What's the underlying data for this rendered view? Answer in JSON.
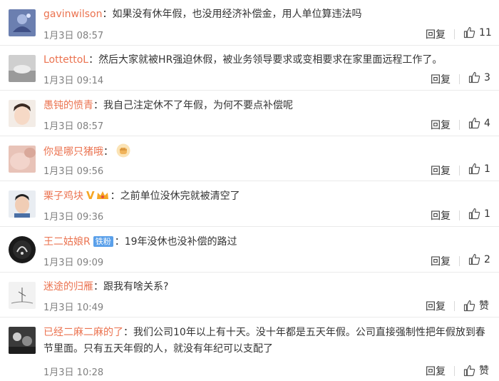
{
  "comments": [
    {
      "username": "gavinwilson",
      "content": "如果没有休年假，也没用经济补偿金，用人单位算违法吗",
      "time": "1月3日 08:57",
      "reply": "回复",
      "likes": "11"
    },
    {
      "username": "LottettoL",
      "content": "然后大家就被HR强迫休假，被业务领导要求或变相要求在家里面远程工作了。",
      "time": "1月3日 09:14",
      "reply": "回复",
      "likes": "3"
    },
    {
      "username": "愚钝的愤青",
      "content": "我自己注定休不了年假，为何不要点补偿呢",
      "time": "1月3日 08:57",
      "reply": "回复",
      "likes": "4"
    },
    {
      "username": "你是哪只猪哦",
      "content": "",
      "time": "1月3日 09:56",
      "reply": "回复",
      "likes": "1",
      "emoji": "fist-emoji"
    },
    {
      "username": "栗子鸡块",
      "content": "之前单位没休完就被清空了",
      "time": "1月3日 09:36",
      "reply": "回复",
      "likes": "1",
      "badge_v": "V"
    },
    {
      "username": "王二姑娘R",
      "content": "19年没休也没补偿的路过",
      "time": "1月3日 09:09",
      "reply": "回复",
      "likes": "2",
      "badge_fan": "铁粉"
    },
    {
      "username": "迷途的归雁",
      "content": "跟我有啥关系?",
      "time": "1月3日 10:49",
      "reply": "回复",
      "likes": "赞"
    },
    {
      "username": "已经二麻二麻的了",
      "content": "我们公司10年以上有十天。没十年都是五天年假。公司直接强制性把年假放到春节里面。只有五天年假的人，就没有年纪可以支配了",
      "time": "1月3日 10:28",
      "reply": "回复",
      "likes": "赞"
    }
  ],
  "colors": {
    "username": "#eb7350",
    "text": "#333333",
    "time": "#808080",
    "divider": "#eaeaea"
  }
}
